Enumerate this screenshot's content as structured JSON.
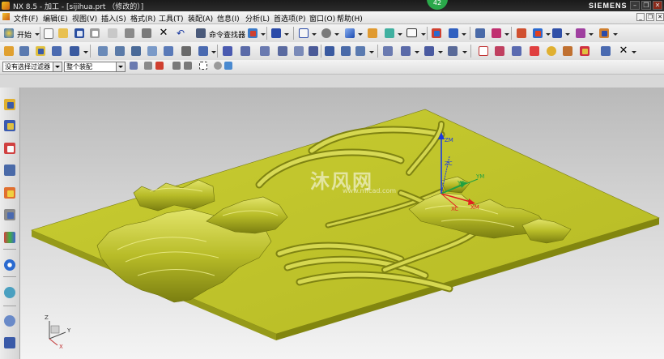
{
  "window": {
    "title": "NX 8.5 - 加工 - [sijihua.prt （修改的）]",
    "brand": "SIEMENS",
    "badge": "42",
    "controls": {
      "minimize": "–",
      "restore": "❐",
      "close": "✕"
    }
  },
  "menu": {
    "items": [
      "文件(F)",
      "编辑(E)",
      "视图(V)",
      "插入(S)",
      "格式(R)",
      "工具(T)",
      "装配(A)",
      "信息(I)",
      "分析(L)",
      "首选项(P)",
      "窗口(O)",
      "帮助(H)"
    ],
    "mdi_controls": {
      "minimize": "_",
      "restore": "❐",
      "close": "✕"
    }
  },
  "toolbar_main": {
    "start_label": "开始",
    "command_finder_label": "命令查找器"
  },
  "filter_bar": {
    "selection_filter": "没有选择过滤器",
    "assembly_scope": "整个装配"
  },
  "viewport": {
    "watermark_text": "沐风网",
    "watermark_url": "www.mfcad.com",
    "wcs_labels": {
      "zm": "ZM",
      "zc": "ZC",
      "ym": "YM",
      "yc": "YC",
      "xm": "XM",
      "xc": "XC"
    },
    "triad_labels": {
      "z": "Z",
      "y": "Y",
      "x": "X"
    },
    "colors": {
      "model_top": "#c4c82e",
      "model_side": "#8f9318",
      "background_top": "#b9b9b9",
      "background_bottom": "#f4f4f4"
    }
  }
}
